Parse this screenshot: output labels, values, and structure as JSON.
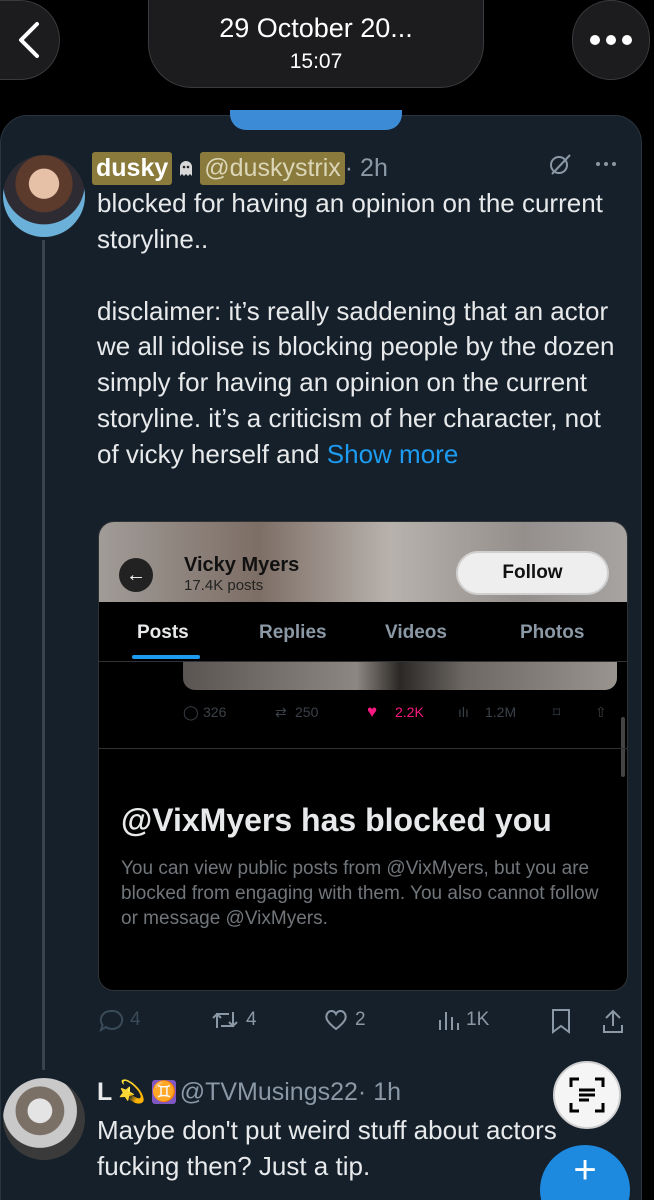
{
  "viewer": {
    "date": "29 October 20...",
    "time": "15:07",
    "back_icon": "chevron-left-icon",
    "more_icon": "ellipsis-icon"
  },
  "tweet": {
    "display_name": "dusky",
    "badge_icon": "ghost-icon",
    "handle": "@duskystrix",
    "time_ago": "· 2h",
    "text_line1": "blocked for having an opinion on the current storyline..",
    "text_para2": "disclaimer: it’s really saddening that an actor we all idolise is blocking people by the dozen simply for having an opinion on the current storyline. it’s a criticism of her character, not of vicky herself and",
    "show_more": "Show more",
    "stats": {
      "replies": "4",
      "reposts": "4",
      "likes": "2",
      "views": "1K"
    }
  },
  "embedded": {
    "profile_name": "Vicky Myers",
    "profile_posts": "17.4K posts",
    "follow_label": "Follow",
    "tabs": [
      "Posts",
      "Replies",
      "Videos",
      "Photos"
    ],
    "active_tab": "Posts",
    "post_stats": {
      "replies": "326",
      "reposts": "250",
      "likes": "2.2K",
      "views": "1.2M"
    },
    "blocked_title": "@VixMyers has blocked you",
    "blocked_desc": "You can view public posts from @VixMyers, but you are blocked from engaging with them. You also cannot follow or message @VixMyers."
  },
  "reply": {
    "display_name": "L",
    "emoji1": "💫",
    "emoji2": "♊",
    "handle": "@TVMusings22",
    "time_ago": "· 1h",
    "text": "Maybe don't put weird stuff about actors fucking then? Just a tip."
  },
  "colors": {
    "panel_bg": "#15202b",
    "accent": "#1d9bf0",
    "like_pink": "#f91880",
    "highlight": "#8a7a3b"
  }
}
